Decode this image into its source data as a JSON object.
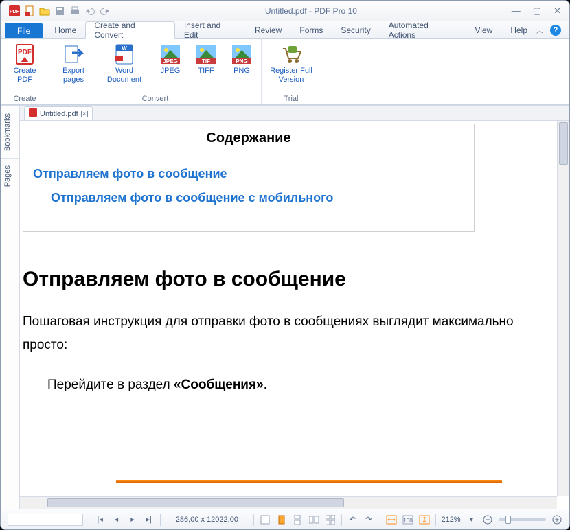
{
  "window": {
    "title": "Untitled.pdf - PDF Pro 10"
  },
  "tabs": {
    "file": "File",
    "items": [
      "Home",
      "Create and Convert",
      "Insert and Edit",
      "Review",
      "Forms",
      "Security",
      "Automated Actions",
      "View",
      "Help"
    ],
    "active_index": 1
  },
  "ribbon": {
    "groups": [
      {
        "caption": "Create",
        "buttons": [
          {
            "label": "Create PDF",
            "icon": "pdf"
          }
        ]
      },
      {
        "caption": "Convert",
        "buttons": [
          {
            "label": "Export pages",
            "icon": "export"
          },
          {
            "label": "Word Document",
            "icon": "word"
          },
          {
            "label": "JPEG",
            "icon": "jpeg"
          },
          {
            "label": "TIFF",
            "icon": "tif"
          },
          {
            "label": "PNG",
            "icon": "png"
          }
        ]
      },
      {
        "caption": "Trial",
        "buttons": [
          {
            "label": "Register Full Version",
            "icon": "cart"
          }
        ]
      }
    ]
  },
  "side_tabs": [
    "Bookmarks",
    "Pages"
  ],
  "doc_tab": {
    "name": "Untitled.pdf"
  },
  "document": {
    "toc_title": "Содержание",
    "toc_links": [
      "Отправляем фото в сообщение",
      "Отправляем фото в сообщение с мобильного"
    ],
    "h1": "Отправляем фото в сообщение",
    "p1": "Пошаговая инструкция для отправки фото в сообщениях выглядит максимально просто:",
    "li_prefix": "Перейдите в раздел ",
    "li_bold": "«Сообщения»",
    "li_suffix": "."
  },
  "status": {
    "coords": "286,00 x 12022,00",
    "zoom_label": "212%"
  }
}
